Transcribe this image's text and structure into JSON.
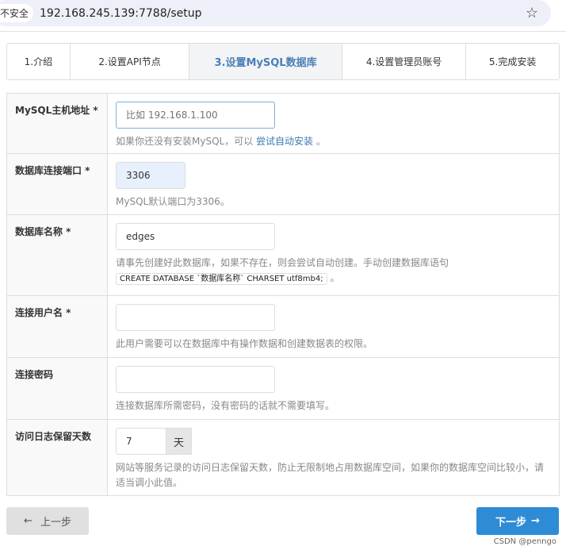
{
  "browser": {
    "security": "不安全",
    "url": "192.168.245.139:7788/setup"
  },
  "steps": [
    "1.介绍",
    "2.设置API节点",
    "3.设置MySQL数据库",
    "4.设置管理员账号",
    "5.完成安装"
  ],
  "form": {
    "host": {
      "label": "MySQL主机地址 *",
      "placeholder": "比如 192.168.1.100",
      "help": "如果你还没有安装MySQL，可以",
      "link": "尝试自动安装",
      "help_end": "。"
    },
    "port": {
      "label": "数据库连接端口 *",
      "value": "3306",
      "help": "MySQL默认端口为3306。"
    },
    "name": {
      "label": "数据库名称 *",
      "value": "edges",
      "help": "请事先创建好此数据库，如果不存在，则会尝试自动创建。手动创建数据库语句",
      "code": "CREATE DATABASE `数据库名称` CHARSET utf8mb4;",
      "code_end": "。"
    },
    "user": {
      "label": "连接用户名 *",
      "value": "",
      "help": "此用户需要可以在数据库中有操作数据和创建数据表的权限。"
    },
    "password": {
      "label": "连接密码",
      "value": "",
      "help": "连接数据库所需密码，没有密码的话就不需要填写。"
    },
    "log_days": {
      "label": "访问日志保留天数",
      "value": "7",
      "unit": "天",
      "help": "网站等服务记录的访问日志保留天数，防止无限制地占用数据库空间，如果你的数据库空间比较小，请适当调小此值。"
    }
  },
  "buttons": {
    "prev": "上一步",
    "next": "下一步"
  },
  "watermark": "CSDN @penngo"
}
